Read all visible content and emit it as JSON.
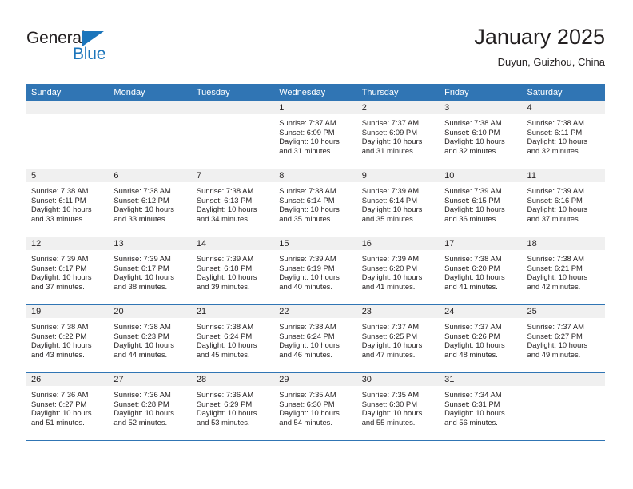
{
  "brand": {
    "name_part1": "General",
    "name_part2": "Blue",
    "triangle_icon": "blue-triangle-icon",
    "color": "#1b75bb"
  },
  "header": {
    "title": "January 2025",
    "subtitle": "Duyun, Guizhou, China"
  },
  "theme": {
    "header_bar": "#3075b4",
    "daynum_band": "#f0f0f0",
    "text": "#231f20"
  },
  "weekday_headers": [
    "Sunday",
    "Monday",
    "Tuesday",
    "Wednesday",
    "Thursday",
    "Friday",
    "Saturday"
  ],
  "weeks": [
    [
      {
        "day": "",
        "sunrise": "",
        "sunset": "",
        "daylight": ""
      },
      {
        "day": "",
        "sunrise": "",
        "sunset": "",
        "daylight": ""
      },
      {
        "day": "",
        "sunrise": "",
        "sunset": "",
        "daylight": ""
      },
      {
        "day": "1",
        "sunrise": "Sunrise: 7:37 AM",
        "sunset": "Sunset: 6:09 PM",
        "daylight": "Daylight: 10 hours and 31 minutes."
      },
      {
        "day": "2",
        "sunrise": "Sunrise: 7:37 AM",
        "sunset": "Sunset: 6:09 PM",
        "daylight": "Daylight: 10 hours and 31 minutes."
      },
      {
        "day": "3",
        "sunrise": "Sunrise: 7:38 AM",
        "sunset": "Sunset: 6:10 PM",
        "daylight": "Daylight: 10 hours and 32 minutes."
      },
      {
        "day": "4",
        "sunrise": "Sunrise: 7:38 AM",
        "sunset": "Sunset: 6:11 PM",
        "daylight": "Daylight: 10 hours and 32 minutes."
      }
    ],
    [
      {
        "day": "5",
        "sunrise": "Sunrise: 7:38 AM",
        "sunset": "Sunset: 6:11 PM",
        "daylight": "Daylight: 10 hours and 33 minutes."
      },
      {
        "day": "6",
        "sunrise": "Sunrise: 7:38 AM",
        "sunset": "Sunset: 6:12 PM",
        "daylight": "Daylight: 10 hours and 33 minutes."
      },
      {
        "day": "7",
        "sunrise": "Sunrise: 7:38 AM",
        "sunset": "Sunset: 6:13 PM",
        "daylight": "Daylight: 10 hours and 34 minutes."
      },
      {
        "day": "8",
        "sunrise": "Sunrise: 7:38 AM",
        "sunset": "Sunset: 6:14 PM",
        "daylight": "Daylight: 10 hours and 35 minutes."
      },
      {
        "day": "9",
        "sunrise": "Sunrise: 7:39 AM",
        "sunset": "Sunset: 6:14 PM",
        "daylight": "Daylight: 10 hours and 35 minutes."
      },
      {
        "day": "10",
        "sunrise": "Sunrise: 7:39 AM",
        "sunset": "Sunset: 6:15 PM",
        "daylight": "Daylight: 10 hours and 36 minutes."
      },
      {
        "day": "11",
        "sunrise": "Sunrise: 7:39 AM",
        "sunset": "Sunset: 6:16 PM",
        "daylight": "Daylight: 10 hours and 37 minutes."
      }
    ],
    [
      {
        "day": "12",
        "sunrise": "Sunrise: 7:39 AM",
        "sunset": "Sunset: 6:17 PM",
        "daylight": "Daylight: 10 hours and 37 minutes."
      },
      {
        "day": "13",
        "sunrise": "Sunrise: 7:39 AM",
        "sunset": "Sunset: 6:17 PM",
        "daylight": "Daylight: 10 hours and 38 minutes."
      },
      {
        "day": "14",
        "sunrise": "Sunrise: 7:39 AM",
        "sunset": "Sunset: 6:18 PM",
        "daylight": "Daylight: 10 hours and 39 minutes."
      },
      {
        "day": "15",
        "sunrise": "Sunrise: 7:39 AM",
        "sunset": "Sunset: 6:19 PM",
        "daylight": "Daylight: 10 hours and 40 minutes."
      },
      {
        "day": "16",
        "sunrise": "Sunrise: 7:39 AM",
        "sunset": "Sunset: 6:20 PM",
        "daylight": "Daylight: 10 hours and 41 minutes."
      },
      {
        "day": "17",
        "sunrise": "Sunrise: 7:38 AM",
        "sunset": "Sunset: 6:20 PM",
        "daylight": "Daylight: 10 hours and 41 minutes."
      },
      {
        "day": "18",
        "sunrise": "Sunrise: 7:38 AM",
        "sunset": "Sunset: 6:21 PM",
        "daylight": "Daylight: 10 hours and 42 minutes."
      }
    ],
    [
      {
        "day": "19",
        "sunrise": "Sunrise: 7:38 AM",
        "sunset": "Sunset: 6:22 PM",
        "daylight": "Daylight: 10 hours and 43 minutes."
      },
      {
        "day": "20",
        "sunrise": "Sunrise: 7:38 AM",
        "sunset": "Sunset: 6:23 PM",
        "daylight": "Daylight: 10 hours and 44 minutes."
      },
      {
        "day": "21",
        "sunrise": "Sunrise: 7:38 AM",
        "sunset": "Sunset: 6:24 PM",
        "daylight": "Daylight: 10 hours and 45 minutes."
      },
      {
        "day": "22",
        "sunrise": "Sunrise: 7:38 AM",
        "sunset": "Sunset: 6:24 PM",
        "daylight": "Daylight: 10 hours and 46 minutes."
      },
      {
        "day": "23",
        "sunrise": "Sunrise: 7:37 AM",
        "sunset": "Sunset: 6:25 PM",
        "daylight": "Daylight: 10 hours and 47 minutes."
      },
      {
        "day": "24",
        "sunrise": "Sunrise: 7:37 AM",
        "sunset": "Sunset: 6:26 PM",
        "daylight": "Daylight: 10 hours and 48 minutes."
      },
      {
        "day": "25",
        "sunrise": "Sunrise: 7:37 AM",
        "sunset": "Sunset: 6:27 PM",
        "daylight": "Daylight: 10 hours and 49 minutes."
      }
    ],
    [
      {
        "day": "26",
        "sunrise": "Sunrise: 7:36 AM",
        "sunset": "Sunset: 6:27 PM",
        "daylight": "Daylight: 10 hours and 51 minutes."
      },
      {
        "day": "27",
        "sunrise": "Sunrise: 7:36 AM",
        "sunset": "Sunset: 6:28 PM",
        "daylight": "Daylight: 10 hours and 52 minutes."
      },
      {
        "day": "28",
        "sunrise": "Sunrise: 7:36 AM",
        "sunset": "Sunset: 6:29 PM",
        "daylight": "Daylight: 10 hours and 53 minutes."
      },
      {
        "day": "29",
        "sunrise": "Sunrise: 7:35 AM",
        "sunset": "Sunset: 6:30 PM",
        "daylight": "Daylight: 10 hours and 54 minutes."
      },
      {
        "day": "30",
        "sunrise": "Sunrise: 7:35 AM",
        "sunset": "Sunset: 6:30 PM",
        "daylight": "Daylight: 10 hours and 55 minutes."
      },
      {
        "day": "31",
        "sunrise": "Sunrise: 7:34 AM",
        "sunset": "Sunset: 6:31 PM",
        "daylight": "Daylight: 10 hours and 56 minutes."
      },
      {
        "day": "",
        "sunrise": "",
        "sunset": "",
        "daylight": ""
      }
    ]
  ]
}
